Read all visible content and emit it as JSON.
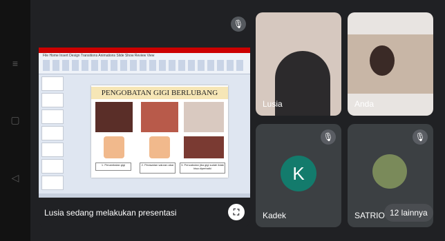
{
  "presentation": {
    "slide_title": "PENGOBATAN GIGI BERLUBANG",
    "captions": [
      "1. Penambalan gigi",
      "2. Perawatan saluran akar",
      "3. Pencabutan jika gigi sudah tidak bisa diperbaiki"
    ],
    "presenting_text": "Lusia sedang melakukan presentasi"
  },
  "participants": [
    {
      "name": "Lusia"
    },
    {
      "name": "Anda"
    },
    {
      "name": "Kadek",
      "initial": "K"
    },
    {
      "name": "SATRIO"
    }
  ],
  "more": "12 lainnya",
  "icons": {
    "mic_off": "mic-off-icon",
    "fullscreen": "fullscreen-icon"
  },
  "colors": {
    "stage": "#202124",
    "tile": "#3c4043",
    "kadek_avatar": "#137b6c"
  }
}
